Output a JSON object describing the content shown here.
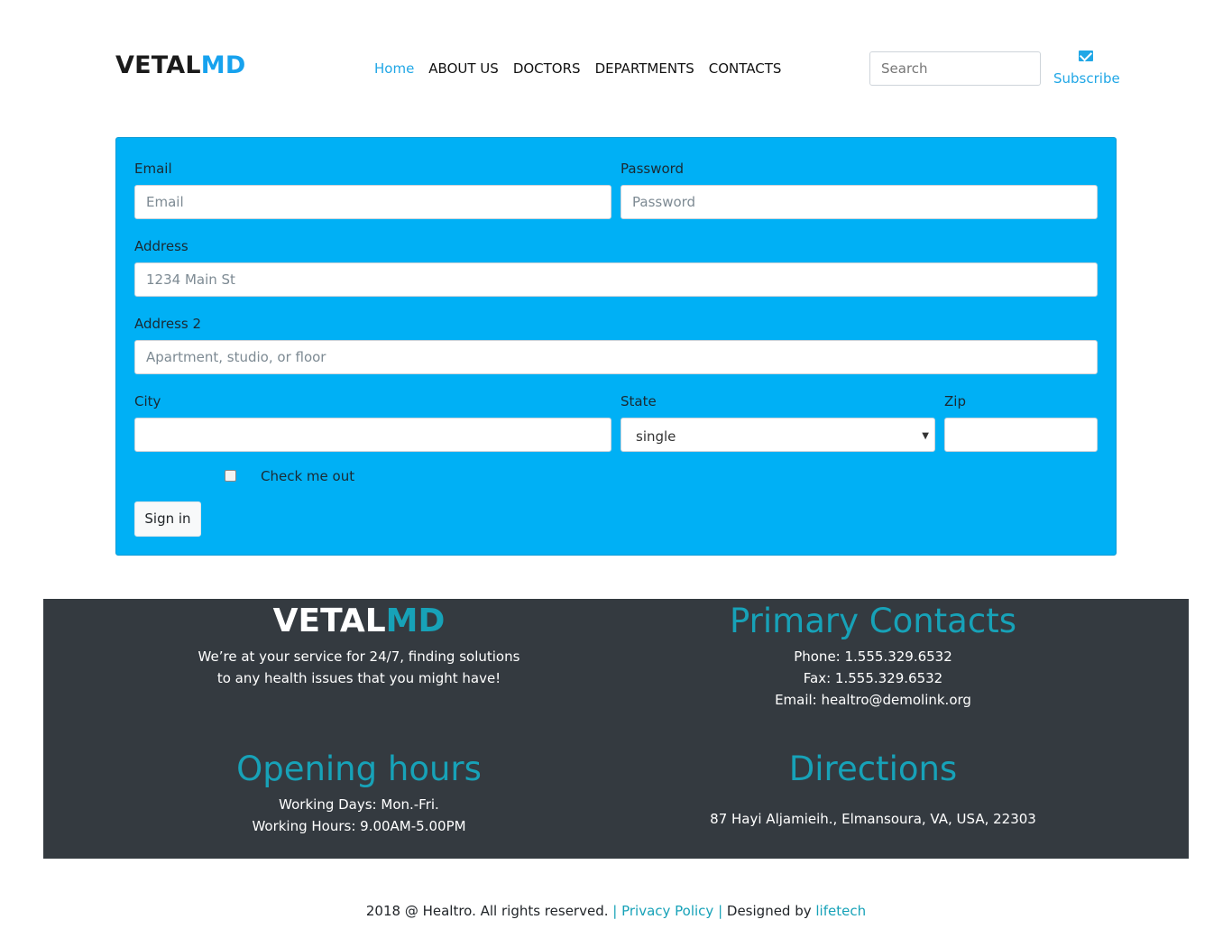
{
  "header": {
    "logo_main": "VETAL",
    "logo_accent": "MD",
    "nav": [
      "Home",
      "ABOUT US",
      "DOCTORS",
      "DEPARTMENTS",
      "CONTACTS"
    ],
    "search_placeholder": "Search",
    "subscribe_label": "Subscribe",
    "subscribe_icon": "envelope-icon"
  },
  "form": {
    "email_label": "Email",
    "email_placeholder": "Email",
    "password_label": "Password",
    "password_placeholder": "Password",
    "address_label": "Address",
    "address_placeholder": "1234 Main St",
    "address2_label": "Address 2",
    "address2_placeholder": "Apartment, studio, or floor",
    "city_label": "City",
    "state_label": "State",
    "state_value": "single",
    "zip_label": "Zip",
    "checkbox_label": "Check me out",
    "submit_label": "Sign in"
  },
  "footer": {
    "logo_main": "VETAL",
    "logo_accent": "MD",
    "tagline_1": "We’re at your service for 24/7, finding solutions",
    "tagline_2": "to any health issues that you might have!",
    "contacts_title": "Primary Contacts",
    "phone": "Phone: 1.555.329.6532",
    "fax": "Fax: 1.555.329.6532",
    "email": "Email: healtro@demolink.org",
    "hours_title": "Opening hours",
    "working_days": "Working Days: Mon.-Fri.",
    "working_hours": "Working Hours: 9.00AM-5.00PM",
    "directions_title": "Directions",
    "address": "87 Hayi Aljamieih., Elmansoura, VA, USA, 22303"
  },
  "copyright": {
    "text": "2018 @ Healtro. All rights reserved.",
    "sep1": " | ",
    "privacy": "Privacy Policy",
    "sep2": " | ",
    "designed": "Designed by ",
    "designer": "lifetech"
  },
  "colors": {
    "accent": "#17a2ee",
    "panel": "#00b0f5",
    "footer_bg": "#343a40",
    "footer_heading": "#17a2b8"
  }
}
